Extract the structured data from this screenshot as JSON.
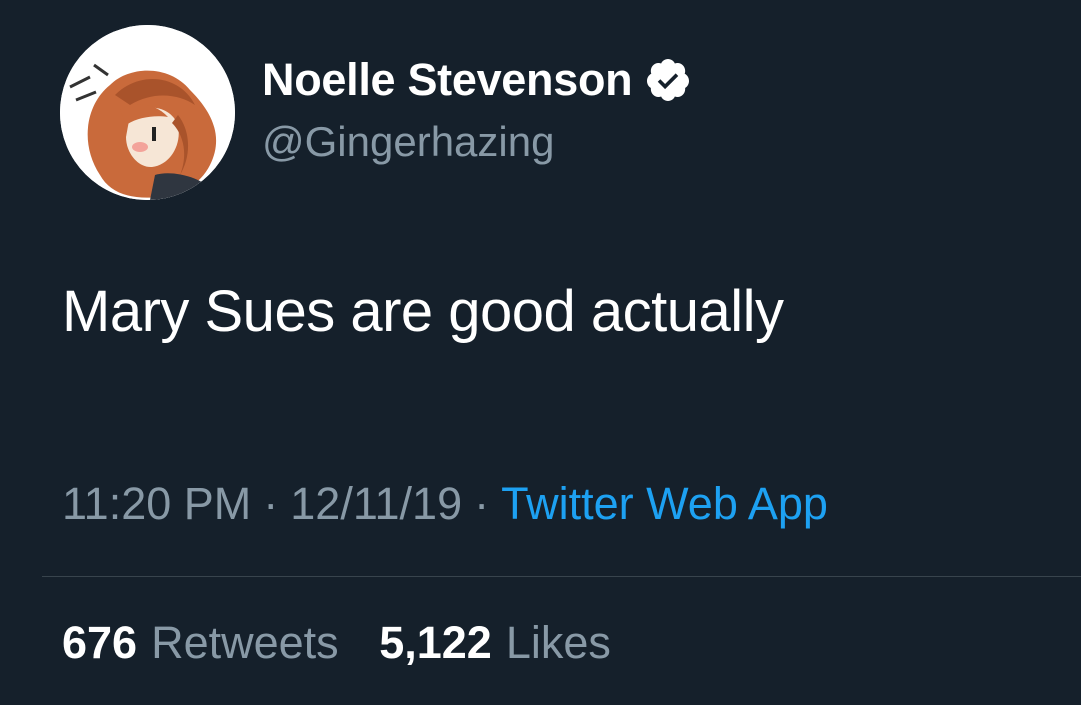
{
  "tweet": {
    "author": {
      "display_name": "Noelle Stevenson",
      "handle": "@Gingerhazing",
      "verified": true,
      "avatar_icon": "avatar-illustration"
    },
    "text": "Mary Sues are good actually",
    "time": "11:20 PM",
    "date": "12/11/19",
    "separator": "·",
    "source": "Twitter Web App",
    "stats": {
      "retweets_count": "676",
      "retweets_label": "Retweets",
      "likes_count": "5,122",
      "likes_label": "Likes"
    }
  },
  "colors": {
    "background": "#15202b",
    "primary_text": "#ffffff",
    "secondary_text": "#8899a6",
    "link": "#1da1f2",
    "divider": "#38444d"
  }
}
